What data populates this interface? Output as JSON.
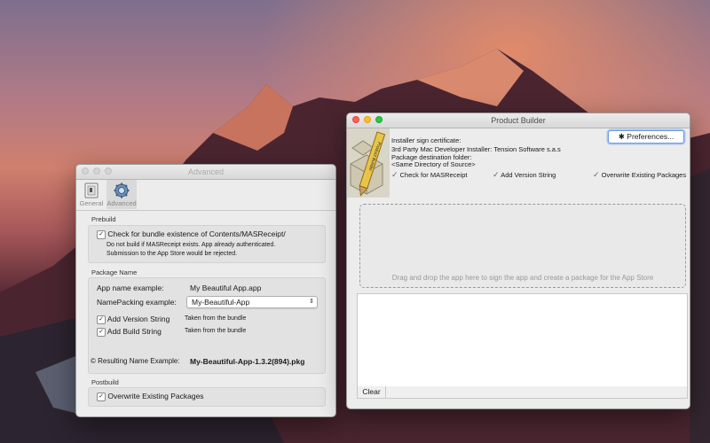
{
  "advanced_window": {
    "title": "Advanced",
    "toolbar": {
      "general_label": "General",
      "advanced_label": "Advanced"
    },
    "prebuild": {
      "section_label": "Prebuild",
      "check_label": "Check for bundle existence of Contents/MASReceipt/",
      "check_mark": "✓",
      "description_line1": "Do not build if MASReceipt exists. App already authenticated.",
      "description_line2": "Submission to the App Store would be rejected."
    },
    "package_name": {
      "section_label": "Package Name",
      "app_name_label": "App name example:",
      "app_name_value": "My Beautiful App.app",
      "name_packing_label": "NamePacking example:",
      "name_packing_value": "My-Beautiful-App",
      "version_label": "Add Version String",
      "version_note": "Taken from the bundle",
      "build_label": "Add Build String",
      "build_note": "Taken from the bundle",
      "check_mark": "✓",
      "result_label": "© Resulting Name Example:",
      "result_value": "My-Beautiful-App-1.3.2(894).pkg"
    },
    "postbuild": {
      "section_label": "Postbuild",
      "overwrite_label": "Overwrite Existing Packages",
      "check_mark": "✓"
    }
  },
  "product_builder": {
    "title": "Product Builder",
    "preferences_label": "Preferences...",
    "cert_label": "Installer sign certificate:",
    "cert_value": "3rd Party Mac Developer Installer: Tension Software s.a.s",
    "dest_label": "Package destination folder:",
    "dest_value": "<Same Directory of Source>",
    "check_mark": "✓",
    "opt_masreceipt": "Check for MASReceipt",
    "opt_version": "Add Version String",
    "opt_overwrite": "Overwrite Existing Packages",
    "dropzone_text": "Drag and drop the app here to sign the app and create a package for the App Store",
    "clear_label": "Clear",
    "icon_text": "Product Builder"
  }
}
